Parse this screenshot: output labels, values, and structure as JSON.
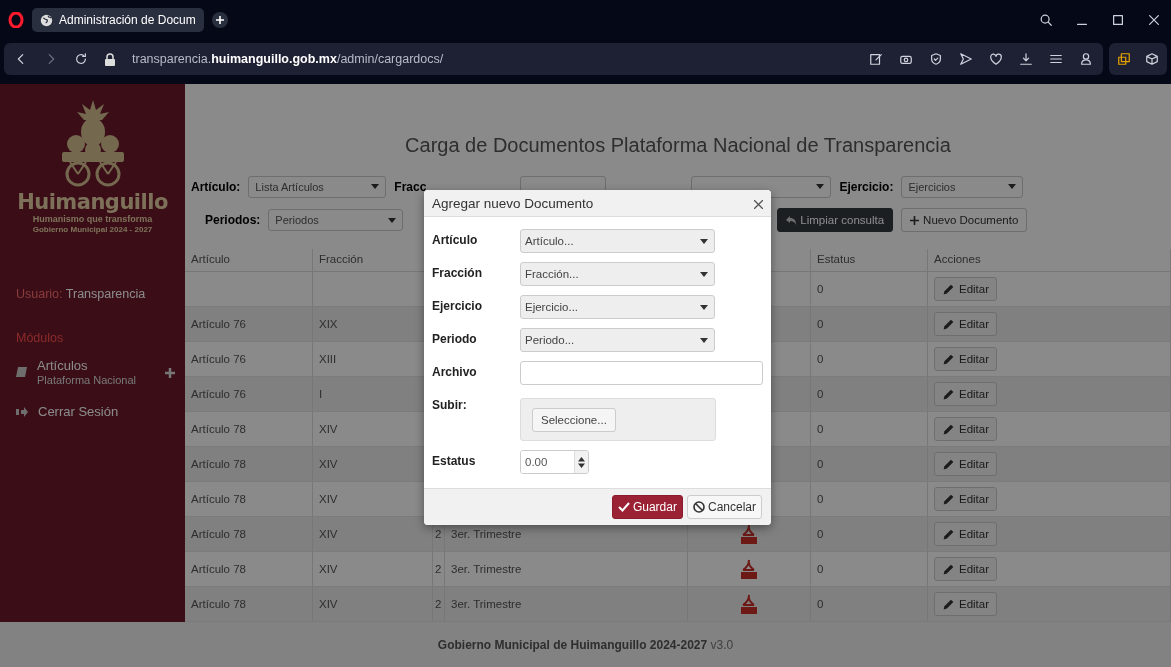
{
  "browser": {
    "tab_title": "Administración de Docum",
    "url": "transparencia.**huimanguillo.gob.mx**/admin/cargardocs/"
  },
  "sidebar": {
    "logo_name": "Huimanguillo",
    "logo_slogan": "Humanismo que transforma",
    "logo_period": "Gobierno Municipal 2024 - 2027",
    "user_label": "Usuario:",
    "user_name": "Transparencia",
    "section": "Módulos",
    "items": [
      {
        "kind": "module",
        "label": "Artículos",
        "sublabel": "Plataforma Nacional"
      },
      {
        "kind": "logout",
        "label": "Cerrar Sesión"
      }
    ]
  },
  "page": {
    "title": "Carga de Documentos Plataforma Nacional de Transparencia",
    "filters_row_1": [
      {
        "label": "Artículo:",
        "value": "Lista Artículos"
      },
      {
        "label": "Fracc"
      },
      {
        "label": "Ejercicio:",
        "value": "Ejercicios"
      }
    ],
    "filters_row_2": [
      {
        "label": "Periodos:",
        "value": "Periodos"
      }
    ],
    "buttons": [
      {
        "kind": "dark",
        "label": "Limpiar consulta"
      },
      {
        "kind": "plain",
        "label": "Nuevo Documento"
      }
    ],
    "table": {
      "columns": [
        "Artículo",
        "Fracción",
        "",
        "",
        "",
        "Estatus",
        "Acciones"
      ],
      "rows": [
        {
          "articulo": "",
          "fraccion": "",
          "estatus": "0",
          "action": "Editar"
        },
        {
          "articulo": "Artículo 76",
          "fraccion": "XIX",
          "estatus": "0",
          "action": "Editar"
        },
        {
          "articulo": "Artículo 76",
          "fraccion": "XIII",
          "estatus": "0",
          "action": "Editar"
        },
        {
          "articulo": "Artículo 76",
          "fraccion": "I",
          "estatus": "0",
          "action": "Editar"
        },
        {
          "articulo": "Artículo 78",
          "fraccion": "XIV",
          "estatus": "0",
          "action": "Editar"
        },
        {
          "articulo": "Artículo 78",
          "fraccion": "XIV",
          "estatus": "0",
          "action": "Editar"
        },
        {
          "articulo": "Artículo 78",
          "fraccion": "XIV",
          "estatus": "0",
          "action": "Editar"
        },
        {
          "articulo": "Artículo 78",
          "fraccion": "XIV",
          "column_3": "2",
          "periodo": "3er. Trimestre",
          "pdf": true,
          "estatus": "0",
          "action": "Editar"
        },
        {
          "articulo": "Artículo 78",
          "fraccion": "XIV",
          "column_3": "2",
          "periodo": "3er. Trimestre",
          "pdf": true,
          "estatus": "0",
          "action": "Editar"
        },
        {
          "articulo": "Artículo 78",
          "fraccion": "XIV",
          "column_3": "2",
          "periodo": "3er. Trimestre",
          "pdf": true,
          "estatus": "0",
          "action": "Editar"
        }
      ]
    }
  },
  "dialog": {
    "title": "Agregar nuevo Documento",
    "fields": [
      {
        "kind": "select",
        "label": "Artículo",
        "placeholder": "Artículo..."
      },
      {
        "kind": "select",
        "label": "Fracción",
        "placeholder": "Fracción..."
      },
      {
        "kind": "select",
        "label": "Ejercicio",
        "placeholder": "Ejercicio..."
      },
      {
        "kind": "select",
        "label": "Periodo",
        "placeholder": "Periodo..."
      },
      {
        "kind": "text",
        "label": "Archivo"
      },
      {
        "kind": "file",
        "label": "Subir:",
        "button": "Seleccione..."
      },
      {
        "kind": "number",
        "label": "Estatus",
        "value": "0.00"
      }
    ],
    "save": "Guardar",
    "cancel": "Cancelar"
  },
  "footer": {
    "text": "**Gobierno Municipal de Huimanguillo 2024-2027** v3.0"
  }
}
